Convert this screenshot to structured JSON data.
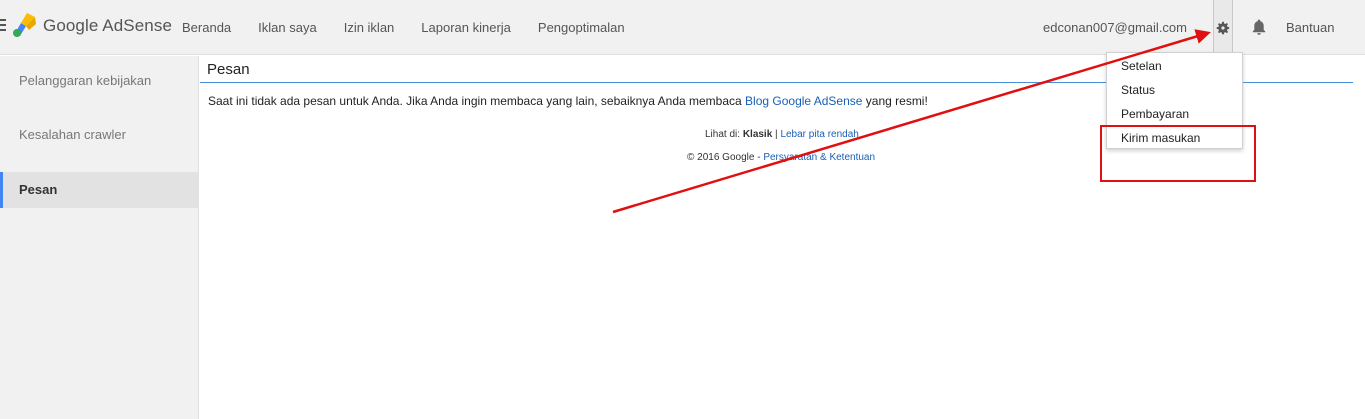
{
  "header": {
    "logo_text": "Google AdSense",
    "nav": [
      "Beranda",
      "Iklan saya",
      "Izin iklan",
      "Laporan kinerja",
      "Pengoptimalan"
    ],
    "account_email": "edconan007@gmail.com",
    "help_label": "Bantuan",
    "icons": [
      "hamburger-icon",
      "adsense-logo-icon",
      "gear-icon",
      "bell-icon"
    ]
  },
  "sidebar": {
    "items": [
      {
        "label": "Pelanggaran kebijakan",
        "active": false
      },
      {
        "label": "Kesalahan crawler",
        "active": false
      },
      {
        "label": "Pesan",
        "active": true
      }
    ]
  },
  "main": {
    "title": "Pesan",
    "message_before": "Saat ini tidak ada pesan untuk Anda. Jika Anda ingin membaca yang lain, sebaiknya Anda membaca ",
    "message_link": "Blog Google AdSense",
    "message_after": " yang resmi!",
    "footer": {
      "view_prefix": "Lihat di: ",
      "view_current": "Klasik",
      "separator": " | ",
      "view_alt": "Lebar pita rendah",
      "copyright": "© 2016 Google - ",
      "terms_link": "Persyaratan & Ketentuan"
    }
  },
  "settings_menu": {
    "items": [
      "Setelan",
      "Status",
      "Pembayaran",
      "Kirim masukan"
    ]
  },
  "colors": {
    "accent_blue": "#4285f4",
    "link_blue": "#1a5fb4",
    "annotation_red": "#e01010"
  }
}
